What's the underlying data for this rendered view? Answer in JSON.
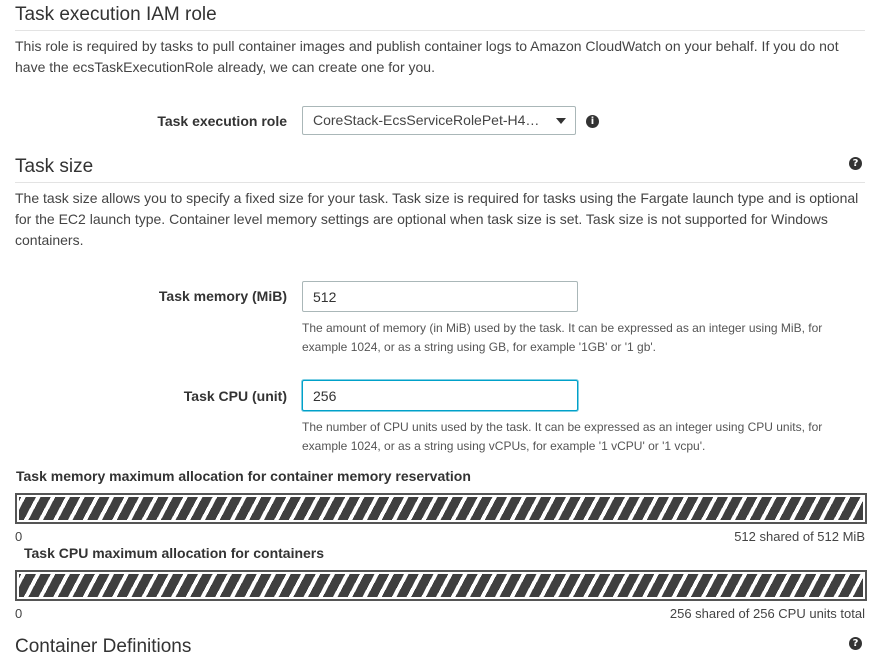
{
  "iam": {
    "title": "Task execution IAM role",
    "description": "This role is required by tasks to pull container images and publish container logs to Amazon CloudWatch on your behalf. If you do not have the ecsTaskExecutionRole already, we can create one for you.",
    "role_label": "Task execution role",
    "role_value": "CoreStack-EcsServiceRolePet-H4…",
    "info_icon": "info-icon"
  },
  "task_size": {
    "title": "Task size",
    "help_icon": "help-icon",
    "description": "The task size allows you to specify a fixed size for your task. Task size is required for tasks using the Fargate launch type and is optional for the EC2 launch type. Container level memory settings are optional when task size is set. Task size is not supported for Windows containers.",
    "memory_label": "Task memory (MiB)",
    "memory_value": "512",
    "memory_hint": "The amount of memory (in MiB) used by the task. It can be expressed as an integer using MiB, for example 1024, or as a string using GB, for example '1GB' or '1 gb'.",
    "cpu_label": "Task CPU (unit)",
    "cpu_value": "256",
    "cpu_hint": "The number of CPU units used by the task. It can be expressed as an integer using CPU units, for example 1024, or as a string using vCPUs, for example '1 vCPU' or '1 vcpu'."
  },
  "memory_alloc": {
    "title": "Task memory maximum allocation for container memory reservation",
    "min": "0",
    "max": "512 shared of 512 MiB",
    "fill_fraction": 1.0
  },
  "cpu_alloc": {
    "title": "Task CPU maximum allocation for containers",
    "min": "0",
    "max": "256 shared of 256 CPU units total",
    "fill_fraction": 1.0
  },
  "container_defs": {
    "title": "Container Definitions",
    "help_icon": "help-icon"
  },
  "colors": {
    "focus_border": "#00a1c9",
    "bar_stripe": "#3f3f3f"
  }
}
